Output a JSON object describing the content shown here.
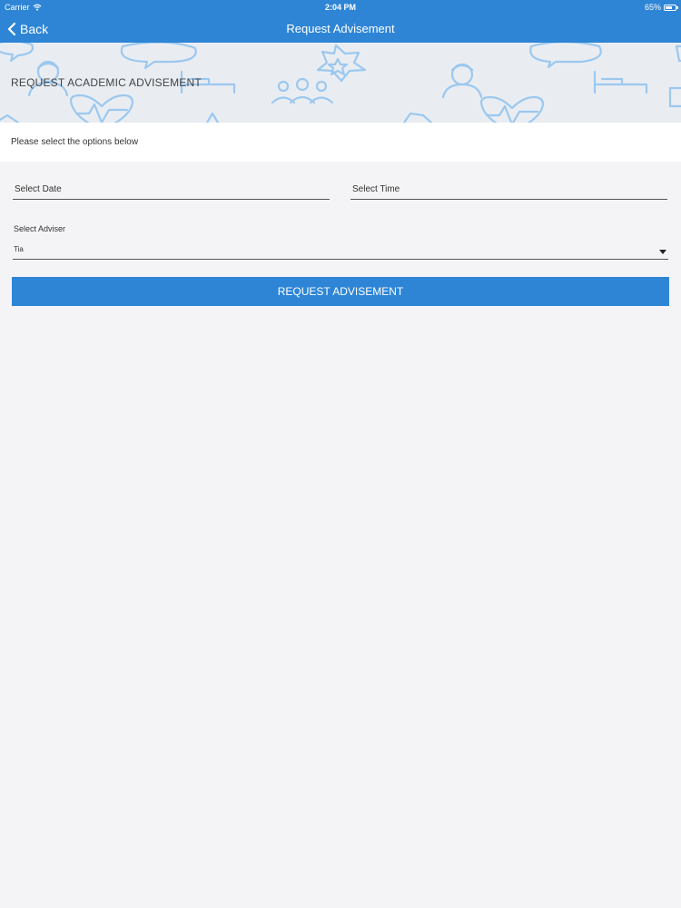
{
  "status_bar": {
    "carrier": "Carrier",
    "time": "2:04 PM",
    "battery": "65%",
    "battery_level": 0.65
  },
  "nav": {
    "back_label": "Back",
    "title": "Request Advisement"
  },
  "banner": {
    "title": "REQUEST ACADEMIC ADVISEMENT"
  },
  "instructions": "Please select the options below",
  "form": {
    "date_label": "Select Date",
    "time_label": "Select Time",
    "adviser_label": "Select Adviser",
    "adviser_value": "Tia",
    "submit_label": "REQUEST ADVISEMENT"
  },
  "colors": {
    "brand": "#2e85d6",
    "banner_icons": "#9cc8ef"
  }
}
